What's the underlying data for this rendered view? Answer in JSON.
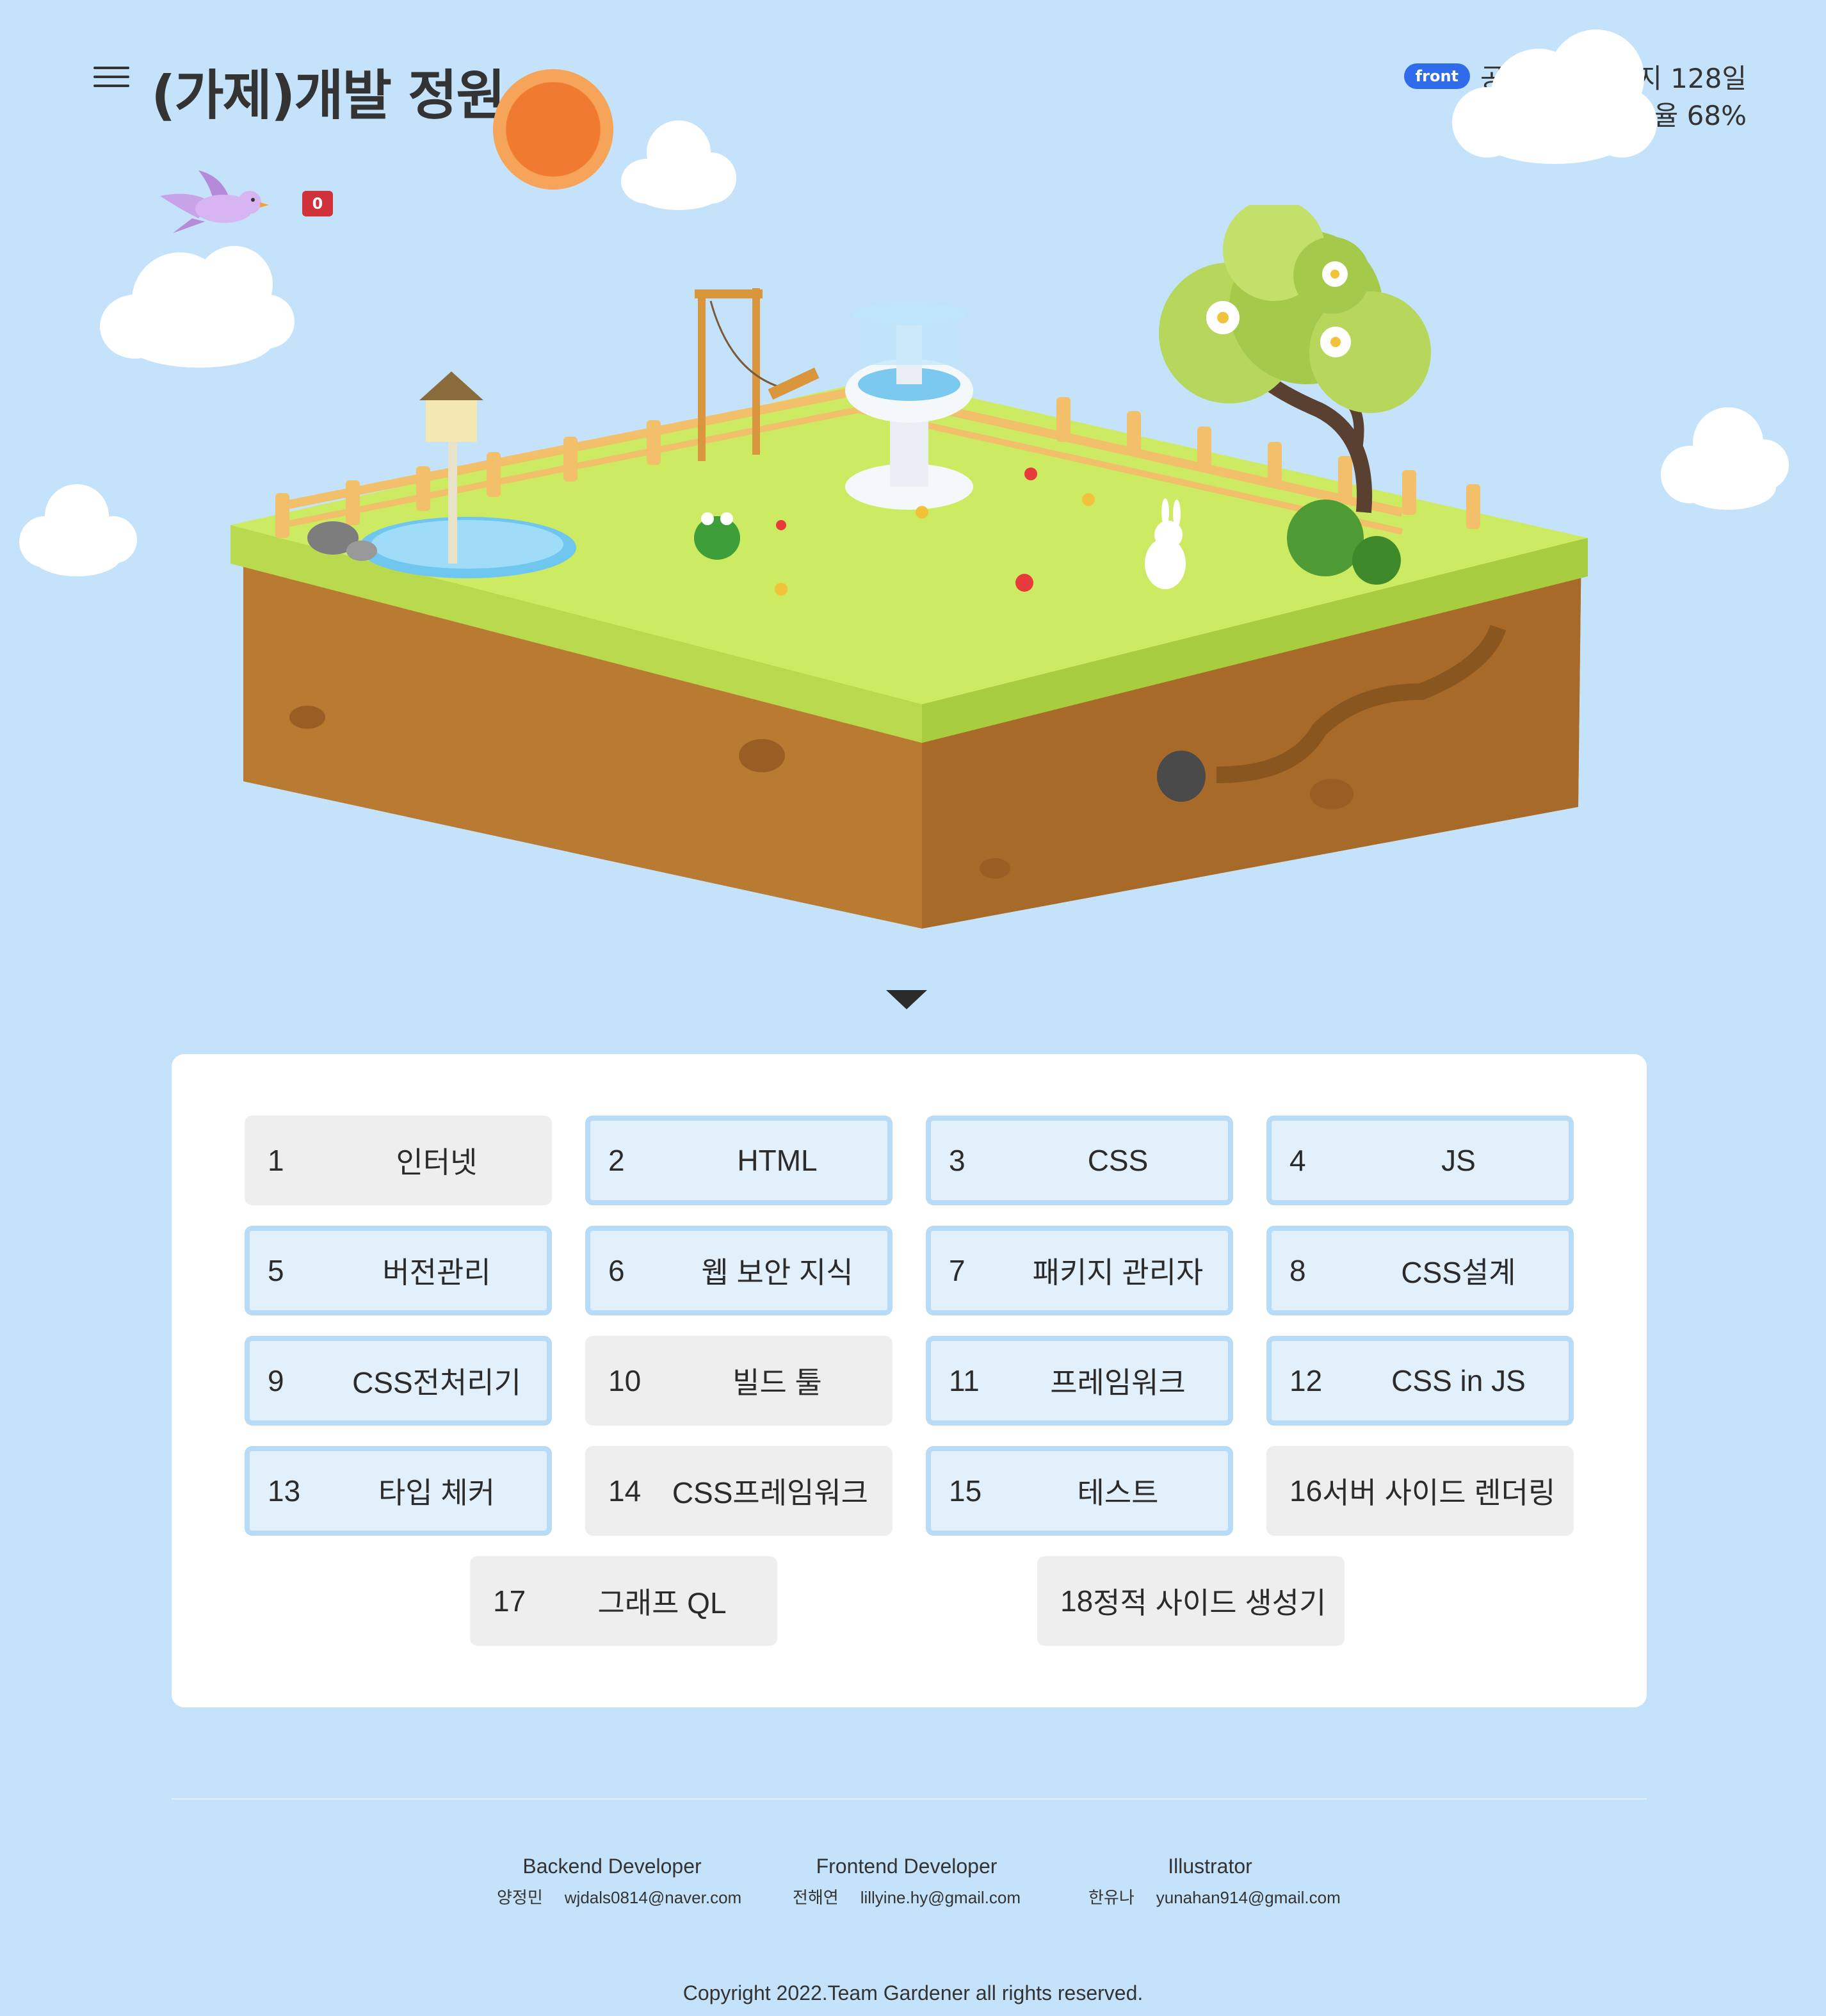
{
  "header": {
    "title": "(가제)개발 정원",
    "track_badge": "front",
    "study_days": "공부를 시작한지 128일",
    "progress_text": "전체 진도율 68%",
    "progress_percent": 68,
    "notification_count": "0"
  },
  "curriculum": [
    {
      "num": "1",
      "label": "인터넷",
      "state": "locked"
    },
    {
      "num": "2",
      "label": "HTML",
      "state": "active"
    },
    {
      "num": "3",
      "label": "CSS",
      "state": "active"
    },
    {
      "num": "4",
      "label": "JS",
      "state": "active"
    },
    {
      "num": "5",
      "label": "버전관리",
      "state": "active"
    },
    {
      "num": "6",
      "label": "웹 보안 지식",
      "state": "active"
    },
    {
      "num": "7",
      "label": "패키지 관리자",
      "state": "active"
    },
    {
      "num": "8",
      "label": "CSS설계",
      "state": "active"
    },
    {
      "num": "9",
      "label": "CSS전처리기",
      "state": "active"
    },
    {
      "num": "10",
      "label": "빌드 툴",
      "state": "locked"
    },
    {
      "num": "11",
      "label": "프레임워크",
      "state": "active"
    },
    {
      "num": "12",
      "label": "CSS in JS",
      "state": "active"
    },
    {
      "num": "13",
      "label": "타입 체커",
      "state": "active"
    },
    {
      "num": "14",
      "label": "CSS프레임워크",
      "state": "locked"
    },
    {
      "num": "15",
      "label": "테스트",
      "state": "active"
    },
    {
      "num": "16",
      "label": "서버 사이드 렌더링",
      "state": "locked"
    },
    {
      "num": "17",
      "label": "그래프 QL",
      "state": "locked"
    },
    {
      "num": "18",
      "label": "정적 사이드 생성기",
      "state": "locked"
    }
  ],
  "footer": {
    "credits": [
      {
        "role": "Backend Developer",
        "name": "양정민",
        "email": "wjdals0814@naver.com"
      },
      {
        "role": "Frontend Developer",
        "name": "전해연",
        "email": "lillyine.hy@gmail.com"
      },
      {
        "role": "Illustrator",
        "name": "한유나",
        "email": "yunahan914@gmail.com"
      }
    ],
    "copyright": "Copyright 2022.Team Gardener all rights reserved."
  },
  "icons": {
    "menu": "hamburger-menu-icon",
    "scroll": "triangle-down-icon"
  },
  "colors": {
    "background": "#c4e2fa",
    "card_active_bg": "#e2f0fc",
    "card_active_border": "#b8dbf7",
    "card_locked_bg": "#eeeeee",
    "badge_blue": "#2f6bea",
    "alert_red": "#d0313a",
    "sun": "#f07a30",
    "grass": "#cdeb62",
    "soil": "#b97a32"
  }
}
